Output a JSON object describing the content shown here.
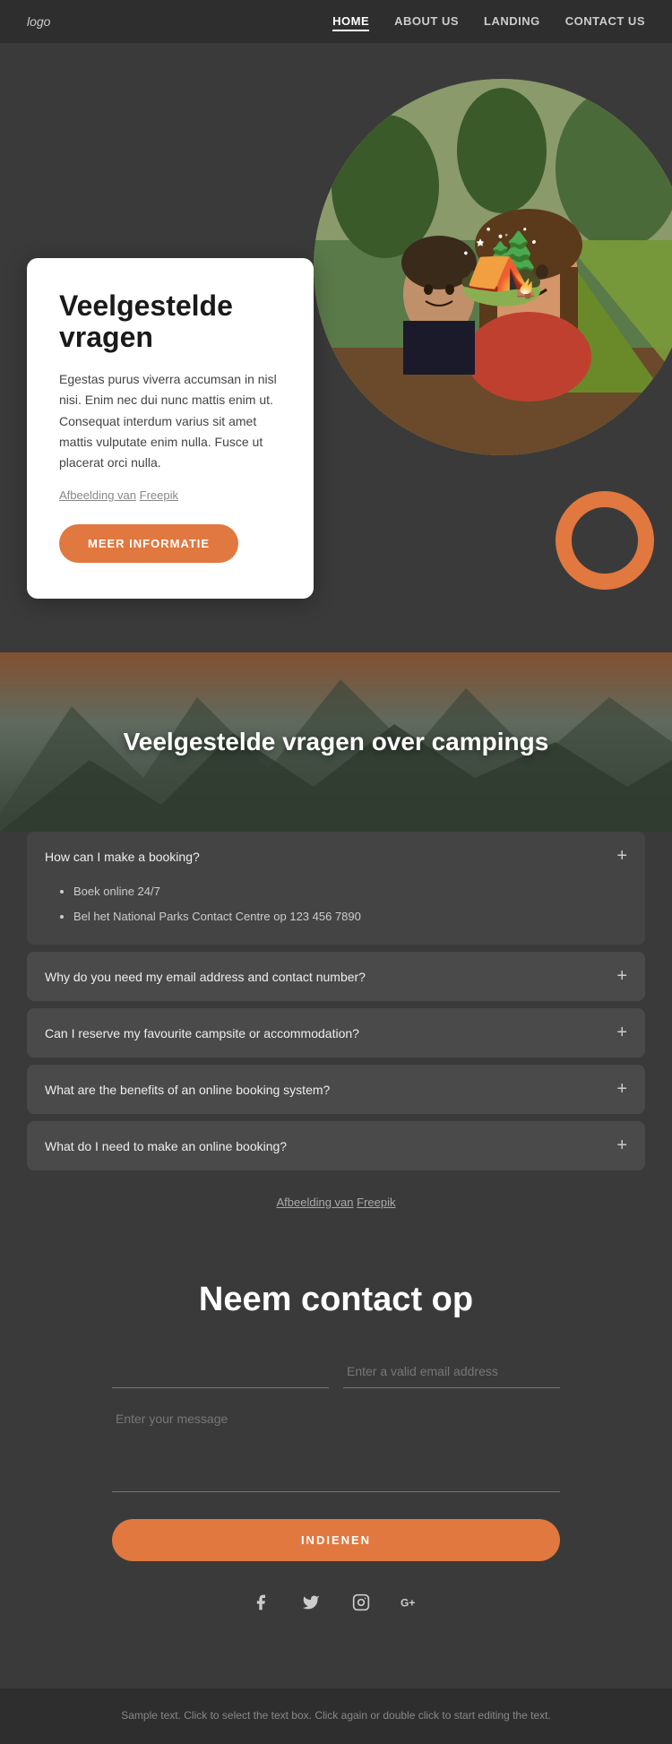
{
  "nav": {
    "logo": "logo",
    "links": [
      {
        "label": "HOME",
        "active": true
      },
      {
        "label": "ABOUT US",
        "active": false
      },
      {
        "label": "LANDING",
        "active": false
      },
      {
        "label": "CONTACT US",
        "active": false
      }
    ]
  },
  "hero": {
    "title": "Veelgestelde vragen",
    "body": "Egestas purus viverra accumsan in nisl nisi. Enim nec dui nunc mattis enim ut. Consequat interdum varius sit amet mattis vulputate enim nulla. Fusce ut placerat orci nulla.",
    "photo_credit": "Afbeelding van",
    "photo_credit_link": "Freepik",
    "cta_button": "MEER INFORMATIE"
  },
  "faq_banner": {
    "title": "Veelgestelde vragen over campings"
  },
  "faq": {
    "items": [
      {
        "question": "How can I make a booking?",
        "open": true,
        "answer_items": [
          "Boek online 24/7",
          "Bel het National Parks Contact Centre op 123 456 7890"
        ]
      },
      {
        "question": "Why do you need my email address and contact number?",
        "open": false,
        "answer_items": []
      },
      {
        "question": "Can I reserve my favourite campsite or accommodation?",
        "open": false,
        "answer_items": []
      },
      {
        "question": "What are the benefits of an online booking system?",
        "open": false,
        "answer_items": []
      },
      {
        "question": "What do I need to make an online booking?",
        "open": false,
        "answer_items": []
      }
    ],
    "photo_credit": "Afbeelding van",
    "photo_credit_link": "Freepik"
  },
  "contact": {
    "title": "Neem contact op",
    "name_placeholder": "",
    "email_placeholder": "Enter a valid email address",
    "message_placeholder": "Enter your message",
    "submit_button": "INDIENEN"
  },
  "social": {
    "icons": [
      {
        "name": "facebook",
        "symbol": "f"
      },
      {
        "name": "twitter",
        "symbol": "t"
      },
      {
        "name": "instagram",
        "symbol": "i"
      },
      {
        "name": "google-plus",
        "symbol": "g+"
      }
    ]
  },
  "footer": {
    "text": "Sample text. Click to select the text box. Click again or double\nclick to start editing the text."
  }
}
